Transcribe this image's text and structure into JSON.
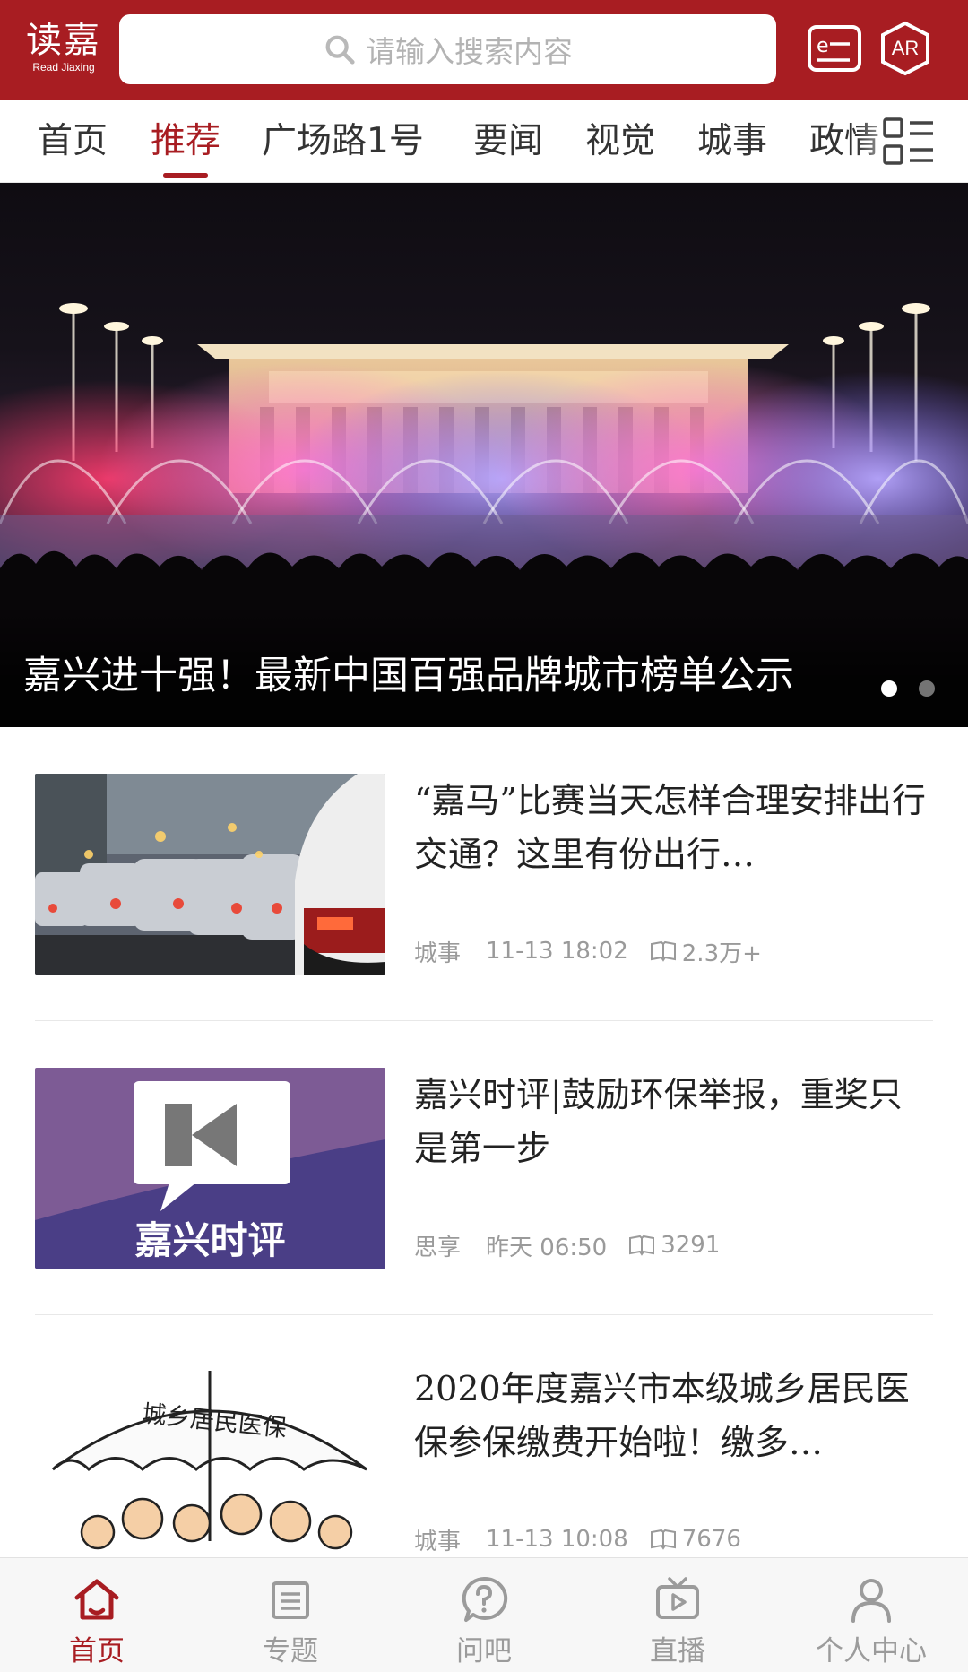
{
  "header": {
    "logo_cn": "读嘉",
    "logo_en": "Read Jiaxing",
    "search_placeholder": "请输入搜索内容",
    "icons": [
      "search-icon",
      "e-news-icon",
      "ar-icon"
    ],
    "ar_label": "AR",
    "brand_color": "#a81d22"
  },
  "tabs": [
    {
      "label": "首页"
    },
    {
      "label": "推荐",
      "active": true
    },
    {
      "label": "广场路1号"
    },
    {
      "label": "要闻"
    },
    {
      "label": "视觉"
    },
    {
      "label": "城事"
    },
    {
      "label": "政情"
    }
  ],
  "banner": {
    "caption": "嘉兴进十强！最新中国百强品牌城市榜单公示",
    "slide_count": 2,
    "active_slide": 1
  },
  "articles": [
    {
      "title": "“嘉马”比赛当天怎样合理安排出行交通？这里有份出行…",
      "category": "城事",
      "time": "11-13  18:02",
      "views": "2.3万+"
    },
    {
      "title": "嘉兴时评|鼓励环保举报，重奖只是第一步",
      "category": "思享",
      "time": "昨天  06:50",
      "views": "3291",
      "thumb_text": "嘉兴时评"
    },
    {
      "title": "2020年度嘉兴市本级城乡居民医保参保缴费开始啦！缴多…",
      "category": "城事",
      "time": "11-13  10:08",
      "views": "7676",
      "thumb_text": "城乡居民医保"
    }
  ],
  "bottom_nav": [
    {
      "label": "首页",
      "icon": "home-icon",
      "active": true
    },
    {
      "label": "专题",
      "icon": "topic-icon"
    },
    {
      "label": "问吧",
      "icon": "question-icon"
    },
    {
      "label": "直播",
      "icon": "tv-icon"
    },
    {
      "label": "个人中心",
      "icon": "user-icon"
    }
  ]
}
